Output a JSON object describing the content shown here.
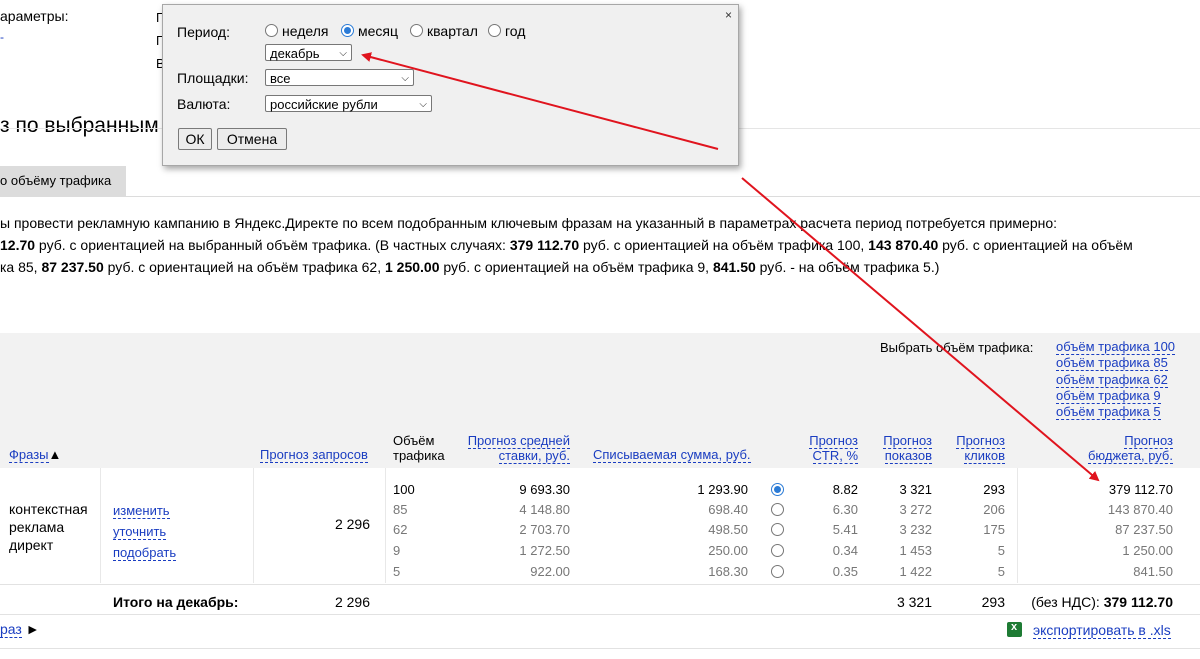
{
  "params": {
    "label": "араметры:",
    "dot": "-"
  },
  "clipped_letters": [
    "П",
    "П",
    "В"
  ],
  "section_title": "з по выбранным",
  "tab_label": "о объёму трафика",
  "summary": {
    "line1": "ы провести рекламную кампанию в Яндекс.Директе по всем подобранным ключевым фразам на указанный в параметрах расчета период потребуется примерно:",
    "l2_a": "12.70",
    "l2_b": " руб. с ориентацией на выбранный объём трафика. (В частных случаях: ",
    "l2_c": "379 112.70",
    "l2_d": " руб. с ориентацией на объём трафика 100, ",
    "l2_e": "143 870.40",
    "l2_f": " руб. с ориентацией на объём",
    "l3_a": "ка 85, ",
    "l3_b": "87 237.50",
    "l3_c": " руб. с ориентацией на объём трафика 62, ",
    "l3_d": "1 250.00",
    "l3_e": " руб. с ориентацией на объём трафика 9, ",
    "l3_f": "841.50",
    "l3_g": " руб. - на объём трафика 5.)"
  },
  "traffic_select": {
    "label": "Выбрать объём трафика:",
    "options": [
      "объём трафика 100",
      "объём трафика 85",
      "объём трафика 62",
      "объём трафика 9",
      "объём трафика 5"
    ]
  },
  "headers": {
    "phrases": "Фразы",
    "sort_arrow": "▲",
    "queries": "Прогноз запросов",
    "traffic1": "Объём",
    "traffic2": "трафика",
    "bid1": "Прогноз средней",
    "bid2": "ставки, руб.",
    "charge": "Списываемая сумма, руб.",
    "ctr1": "Прогноз",
    "ctr2": "CTR, %",
    "shows1": "Прогноз",
    "shows2": "показов",
    "clicks1": "Прогноз",
    "clicks2": "кликов",
    "budget1": "Прогноз",
    "budget2": "бюджета, руб."
  },
  "phrase": {
    "l1": "контекстная",
    "l2": "реклама",
    "l3": "директ",
    "actions": [
      "изменить",
      "уточнить",
      "подобрать"
    ],
    "queries": "2 296"
  },
  "rows": [
    {
      "traffic": "100",
      "bid": "9 693.30",
      "charge": "1 293.90",
      "ctr": "8.82",
      "shows": "3 321",
      "clicks": "293",
      "budget": "379 112.70",
      "selected": true
    },
    {
      "traffic": "85",
      "bid": "4 148.80",
      "charge": "698.40",
      "ctr": "6.30",
      "shows": "3 272",
      "clicks": "206",
      "budget": "143 870.40",
      "selected": false
    },
    {
      "traffic": "62",
      "bid": "2 703.70",
      "charge": "498.50",
      "ctr": "5.41",
      "shows": "3 232",
      "clicks": "175",
      "budget": "87 237.50",
      "selected": false
    },
    {
      "traffic": "9",
      "bid": "1 272.50",
      "charge": "250.00",
      "ctr": "0.34",
      "shows": "1 453",
      "clicks": "5",
      "budget": "1 250.00",
      "selected": false
    },
    {
      "traffic": "5",
      "bid": "922.00",
      "charge": "168.30",
      "ctr": "0.35",
      "shows": "1 422",
      "clicks": "5",
      "budget": "841.50",
      "selected": false
    }
  ],
  "total": {
    "label": "Итого на декабрь:",
    "queries": "2 296",
    "shows": "3 321",
    "clicks": "293",
    "budget_prefix": "(без НДС): ",
    "budget": "379 112.70"
  },
  "footer": {
    "phrases_link": "раз",
    "arrow": "►",
    "export": "экспортировать в .xls"
  },
  "dialog": {
    "period_label": "Период:",
    "period_options": [
      "неделя",
      "месяц",
      "квартал",
      "год"
    ],
    "period_selected": "месяц",
    "month": "декабрь",
    "areas_label": "Площадки:",
    "areas_value": "все",
    "currency_label": "Валюта:",
    "currency_value": "российские рубли",
    "ok": "ОК",
    "cancel": "Отмена",
    "close": "×"
  },
  "colors": {
    "link": "#1a3dc1",
    "arrow": "#e0141e",
    "radio": "#2b7bd6"
  }
}
